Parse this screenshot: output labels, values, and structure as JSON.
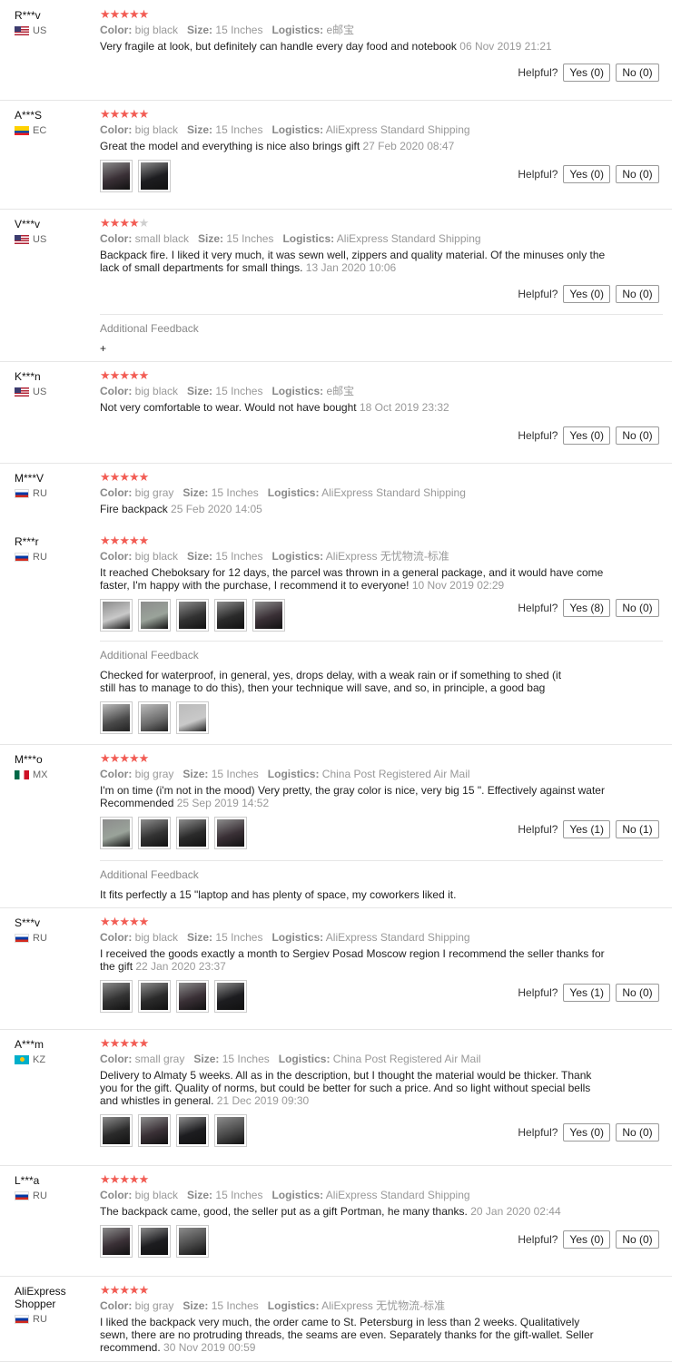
{
  "labels": {
    "color": "Color:",
    "size": "Size:",
    "logistics": "Logistics:",
    "helpful": "Helpful?",
    "additional_feedback": "Additional Feedback"
  },
  "colors": {
    "star": "#f25c54",
    "star_off": "#cfcfcf",
    "meta": "#999999"
  },
  "reviews": [
    {
      "user": "R***v",
      "country": "US",
      "rating": 5,
      "color": "big black",
      "size": "15 Inches",
      "logistics": "e邮宝",
      "text": "Very fragile at look, but definitely can handle every day food and notebook",
      "date": "06 Nov 2019 21:21",
      "yes": "Yes (0)",
      "no": "No (0)",
      "photos": 0
    },
    {
      "user": "A***S",
      "country": "EC",
      "rating": 5,
      "color": "big black",
      "size": "15 Inches",
      "logistics": "AliExpress Standard Shipping",
      "text": "Great the model and everything is nice also brings gift",
      "date": "27 Feb 2020 08:47",
      "yes": "Yes (0)",
      "no": "No (0)",
      "photos": 2
    },
    {
      "user": "V***v",
      "country": "US",
      "rating": 4,
      "color": "small black",
      "size": "15 Inches",
      "logistics": "AliExpress Standard Shipping",
      "text": "Backpack fire. I liked it very much, it was sewn well, zippers and quality material. Of the minuses only the lack of small departments for small things.",
      "date": "13 Jan 2020 10:06",
      "yes": "Yes (0)",
      "no": "No (0)",
      "photos": 0,
      "additional": "+"
    },
    {
      "user": "K***n",
      "country": "US",
      "rating": 5,
      "color": "big black",
      "size": "15 Inches",
      "logistics": "e邮宝",
      "text": "Not very comfortable to wear. Would not have bought",
      "date": "18 Oct 2019 23:32",
      "yes": "Yes (0)",
      "no": "No (0)",
      "photos": 0
    },
    {
      "user": "M***V",
      "country": "RU",
      "rating": 5,
      "color": "big gray",
      "size": "15 Inches",
      "logistics": "AliExpress Standard Shipping",
      "text": "Fire backpack",
      "date": "25 Feb 2020 14:05",
      "photos": 0
    },
    {
      "user": "R***r",
      "country": "RU",
      "rating": 5,
      "color": "big black",
      "size": "15 Inches",
      "logistics": "AliExpress 无忧物流-标准",
      "text": "It reached Cheboksary for 12 days, the parcel was thrown in a general package, and it would have come faster, I'm happy with the purchase, I recommend it to everyone!",
      "date": "10 Nov 2019 02:29",
      "yes": "Yes (8)",
      "no": "No (0)",
      "photos": 5,
      "additional": "Checked for waterproof, in general, yes, drops delay, with a weak rain or if something to shed (it still has to manage to do this), then your technique will save, and so, in principle, a good bag",
      "additional_photos": 3
    },
    {
      "user": "M***o",
      "country": "MX",
      "rating": 5,
      "color": "big gray",
      "size": "15 Inches",
      "logistics": "China Post Registered Air Mail",
      "text": "I'm on time (i'm not in the mood) Very pretty, the gray color is nice, very big 15 \". Effectively against water Recommended",
      "date": "25 Sep 2019 14:52",
      "yes": "Yes (1)",
      "no": "No (1)",
      "photos": 4,
      "additional": "It fits perfectly a 15 \"laptop and has plenty of space, my coworkers liked it."
    },
    {
      "user": "S***v",
      "country": "RU",
      "rating": 5,
      "color": "big black",
      "size": "15 Inches",
      "logistics": "AliExpress Standard Shipping",
      "text": "I received the goods exactly a month to Sergiev Posad Moscow region I recommend the seller thanks for the gift",
      "date": "22 Jan 2020 23:37",
      "yes": "Yes (1)",
      "no": "No (0)",
      "photos": 4
    },
    {
      "user": "A***m",
      "country": "KZ",
      "rating": 5,
      "color": "small gray",
      "size": "15 Inches",
      "logistics": "China Post Registered Air Mail",
      "text": "Delivery to Almaty 5 weeks. All as in the description, but I thought the material would be thicker. Thank you for the gift. Quality of norms, but could be better for such a price. And so light without special bells and whistles in general.",
      "date": "21 Dec 2019 09:30",
      "yes": "Yes (0)",
      "no": "No (0)",
      "photos": 4
    },
    {
      "user": "L***a",
      "country": "RU",
      "rating": 5,
      "color": "big black",
      "size": "15 Inches",
      "logistics": "AliExpress Standard Shipping",
      "text": "The backpack came, good, the seller put as a gift Portman, he many thanks.",
      "date": "20 Jan 2020 02:44",
      "yes": "Yes (0)",
      "no": "No (0)",
      "photos": 3
    },
    {
      "user": "AliExpress Shopper",
      "country": "RU",
      "rating": 5,
      "color": "big gray",
      "size": "15 Inches",
      "logistics": "AliExpress 无忧物流-标准",
      "text": "I liked the backpack very much, the order came to St. Petersburg in less than 2 weeks. Qualitatively sewn, there are no protruding threads, the seams are even. Separately thanks for the gift-wallet. Seller recommend.",
      "date": "30 Nov 2019 00:59",
      "photos": 0
    }
  ]
}
